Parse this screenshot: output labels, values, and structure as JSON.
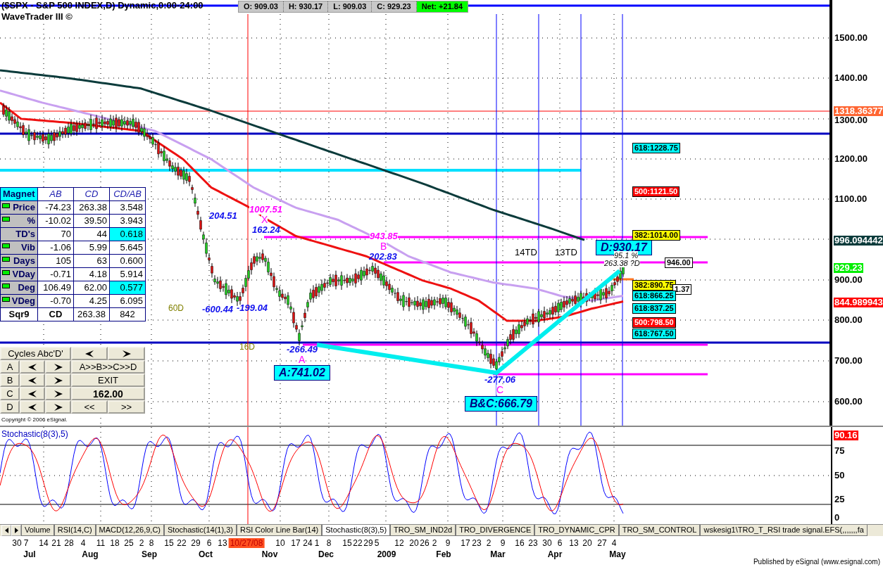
{
  "header": {
    "title": "($SPX - S&P 500 INDEX,D) Dynamic,0:00-24:00",
    "subtitle": "WaveTrader III ©",
    "quote": [
      {
        "text": "O: 909.03",
        "kind": "plain"
      },
      {
        "text": "H: 930.17",
        "kind": "plain"
      },
      {
        "text": "L: 909.03",
        "kind": "plain"
      },
      {
        "text": "C: 929.23",
        "kind": "plain"
      },
      {
        "text": "Net: +21.84",
        "kind": "net"
      }
    ]
  },
  "price_axis": {
    "ticks": [
      "1500.00",
      "1400.00",
      "1300.00",
      "1200.00",
      "1100.00",
      "900.00",
      "800.00",
      "700.00",
      "600.00"
    ],
    "badges": [
      {
        "text": "1318.36377",
        "color": "#ff6633"
      },
      {
        "text": "996.094442",
        "color": "#0b3b3b"
      },
      {
        "text": "929.23",
        "color": "#00ee00"
      },
      {
        "text": "844.989943",
        "color": "#ff0000"
      }
    ]
  },
  "annotations": [
    {
      "text": "1007.51",
      "kind": "price"
    },
    {
      "text": "X",
      "kind": "point"
    },
    {
      "text": "204.51",
      "kind": "swing"
    },
    {
      "text": "162.24",
      "kind": "swing"
    },
    {
      "text": "943.85",
      "kind": "price"
    },
    {
      "text": "B",
      "kind": "point"
    },
    {
      "text": "202.83",
      "kind": "swing"
    },
    {
      "text": "14TD",
      "kind": "td"
    },
    {
      "text": "13TD",
      "kind": "td"
    },
    {
      "text": "D:930.17",
      "kind": "box"
    },
    {
      "text": "95.1 %",
      "kind": "note"
    },
    {
      "text": "263.38 ?D",
      "kind": "note"
    },
    {
      "text": "60D",
      "kind": "count"
    },
    {
      "text": "-600.44",
      "kind": "swing"
    },
    {
      "text": "-199.04",
      "kind": "swing"
    },
    {
      "text": "16D",
      "kind": "count"
    },
    {
      "text": "-266.49",
      "kind": "swing"
    },
    {
      "text": "A",
      "kind": "point"
    },
    {
      "text": "A:741.02",
      "kind": "box"
    },
    {
      "text": "-277.06",
      "kind": "swing"
    },
    {
      "text": "C",
      "kind": "point"
    },
    {
      "text": "B&C:666.79",
      "kind": "box"
    }
  ],
  "levels": [
    {
      "text": "618:1228.75",
      "color": "#00ffff"
    },
    {
      "text": "500:1121.50",
      "color": "#ff0000"
    },
    {
      "text": "382:1014.00",
      "color": "#ffff00"
    },
    {
      "text": "946.00",
      "color": "#ffffff"
    },
    {
      "text": "382:890.75",
      "color": "#ffff00"
    },
    {
      "text": "1.37",
      "color": "#ffffff"
    },
    {
      "text": "618:866.25",
      "color": "#00ffff"
    },
    {
      "text": "618:837.25",
      "color": "#00ffff"
    },
    {
      "text": "500:798.50",
      "color": "#ff0000"
    },
    {
      "text": "618:767.50",
      "color": "#00ffff"
    }
  ],
  "table": {
    "corner": "Magnet",
    "columns": [
      "AB",
      "CD",
      "CD/AB"
    ],
    "rows": [
      {
        "label": "Price",
        "indicator": true,
        "ab": "-74.23",
        "cd": "263.38",
        "ratio": {
          "text": "3.548",
          "highlighted": false
        }
      },
      {
        "label": "%",
        "indicator": true,
        "ab": "-10.02",
        "cd": "39.50",
        "ratio": {
          "text": "3.943",
          "highlighted": false
        }
      },
      {
        "label": "TD's",
        "indicator": false,
        "ab": "70",
        "cd": "44",
        "ratio": {
          "text": "0.618",
          "highlighted": true
        }
      },
      {
        "label": "Vib",
        "indicator": true,
        "ab": "-1.06",
        "cd": "5.99",
        "ratio": {
          "text": "5.645",
          "highlighted": false
        }
      },
      {
        "label": "Days",
        "indicator": true,
        "ab": "105",
        "cd": "63",
        "ratio": {
          "text": "0.600",
          "highlighted": false
        }
      },
      {
        "label": "VDay",
        "indicator": true,
        "ab": "-0.71",
        "cd": "4.18",
        "ratio": {
          "text": "5.914",
          "highlighted": false
        }
      },
      {
        "label": "Deg",
        "indicator": true,
        "ab": "106.49",
        "cd": "62.00",
        "ratio": {
          "text": "0.577",
          "highlighted": true
        }
      },
      {
        "label": "VDeg",
        "indicator": true,
        "ab": "-0.70",
        "cd": "4.25",
        "ratio": {
          "text": "6.095",
          "highlighted": false
        }
      }
    ],
    "footer": [
      "Sqr9",
      "CD",
      "263.38",
      "842"
    ]
  },
  "controls": {
    "cycles_button": "Cycles Abc'D'",
    "points": [
      "A",
      "B",
      "C",
      "D"
    ],
    "actions": [
      "A>>B>>C>>D",
      "EXIT"
    ],
    "value": "162.00",
    "step_buttons": [
      "<<",
      ">>"
    ]
  },
  "copyright": "Copyright © 2006 eSignal.",
  "stochastic": {
    "label": "Stochastic(8(3),5)",
    "ticks": [
      "75",
      "50",
      "25",
      "0"
    ],
    "badge": {
      "text": "90.16",
      "color": "#ff0000"
    }
  },
  "tabs": [
    {
      "label": "Volume",
      "selected": false
    },
    {
      "label": "RSI(14,C)",
      "selected": false
    },
    {
      "label": "MACD(12,26,9,C)",
      "selected": false
    },
    {
      "label": "Stochastic(14(1),3)",
      "selected": false
    },
    {
      "label": "RSI Color Line Bar(14)",
      "selected": false
    },
    {
      "label": "Stochastic(8(3),5)",
      "selected": true
    },
    {
      "label": "TRO_SM_IND2d",
      "selected": false
    },
    {
      "label": "TRO_DIVERGENCE",
      "selected": false
    },
    {
      "label": "TRO_DYNAMIC_CPR",
      "selected": false
    },
    {
      "label": "TRO_SM_CONTROL",
      "selected": false
    },
    {
      "label": "wskesig1\\TRO_T_RSI trade signal.EFS(,,,,,,,fa",
      "selected": false
    }
  ],
  "date_axis": {
    "days": [
      {
        "text": "30",
        "kind": "day"
      },
      {
        "text": "7",
        "kind": "day"
      },
      {
        "text": "14",
        "kind": "day"
      },
      {
        "text": "21",
        "kind": "day"
      },
      {
        "text": "28",
        "kind": "day"
      },
      {
        "text": "4",
        "kind": "day"
      },
      {
        "text": "11",
        "kind": "day"
      },
      {
        "text": "18",
        "kind": "day"
      },
      {
        "text": "25",
        "kind": "day"
      },
      {
        "text": "2",
        "kind": "day"
      },
      {
        "text": "8",
        "kind": "day"
      },
      {
        "text": "15",
        "kind": "day"
      },
      {
        "text": "22",
        "kind": "day"
      },
      {
        "text": "29",
        "kind": "day"
      },
      {
        "text": "6",
        "kind": "day"
      },
      {
        "text": "13",
        "kind": "day"
      },
      {
        "text": "10/27/08",
        "kind": "cursor"
      },
      {
        "text": "10",
        "kind": "day"
      },
      {
        "text": "17",
        "kind": "day"
      },
      {
        "text": "24",
        "kind": "day"
      },
      {
        "text": "1",
        "kind": "day"
      },
      {
        "text": "8",
        "kind": "day"
      },
      {
        "text": "15",
        "kind": "day"
      },
      {
        "text": "22",
        "kind": "day"
      },
      {
        "text": "29",
        "kind": "day"
      },
      {
        "text": "5",
        "kind": "day"
      },
      {
        "text": "12",
        "kind": "day"
      },
      {
        "text": "20",
        "kind": "day"
      },
      {
        "text": "26",
        "kind": "day"
      },
      {
        "text": "2",
        "kind": "day"
      },
      {
        "text": "9",
        "kind": "day"
      },
      {
        "text": "17",
        "kind": "day"
      },
      {
        "text": "23",
        "kind": "day"
      },
      {
        "text": "2",
        "kind": "day"
      },
      {
        "text": "9",
        "kind": "day"
      },
      {
        "text": "16",
        "kind": "day"
      },
      {
        "text": "23",
        "kind": "day"
      },
      {
        "text": "30",
        "kind": "day"
      },
      {
        "text": "6",
        "kind": "day"
      },
      {
        "text": "13",
        "kind": "day"
      },
      {
        "text": "20",
        "kind": "day"
      },
      {
        "text": "27",
        "kind": "day"
      },
      {
        "text": "4",
        "kind": "day"
      }
    ],
    "months": [
      "Jul",
      "Aug",
      "Sep",
      "Oct",
      "Nov",
      "Dec",
      "2009",
      "Feb",
      "Mar",
      "Apr",
      "May"
    ]
  },
  "footer": "Published by eSignal (www.esignal.com)"
}
